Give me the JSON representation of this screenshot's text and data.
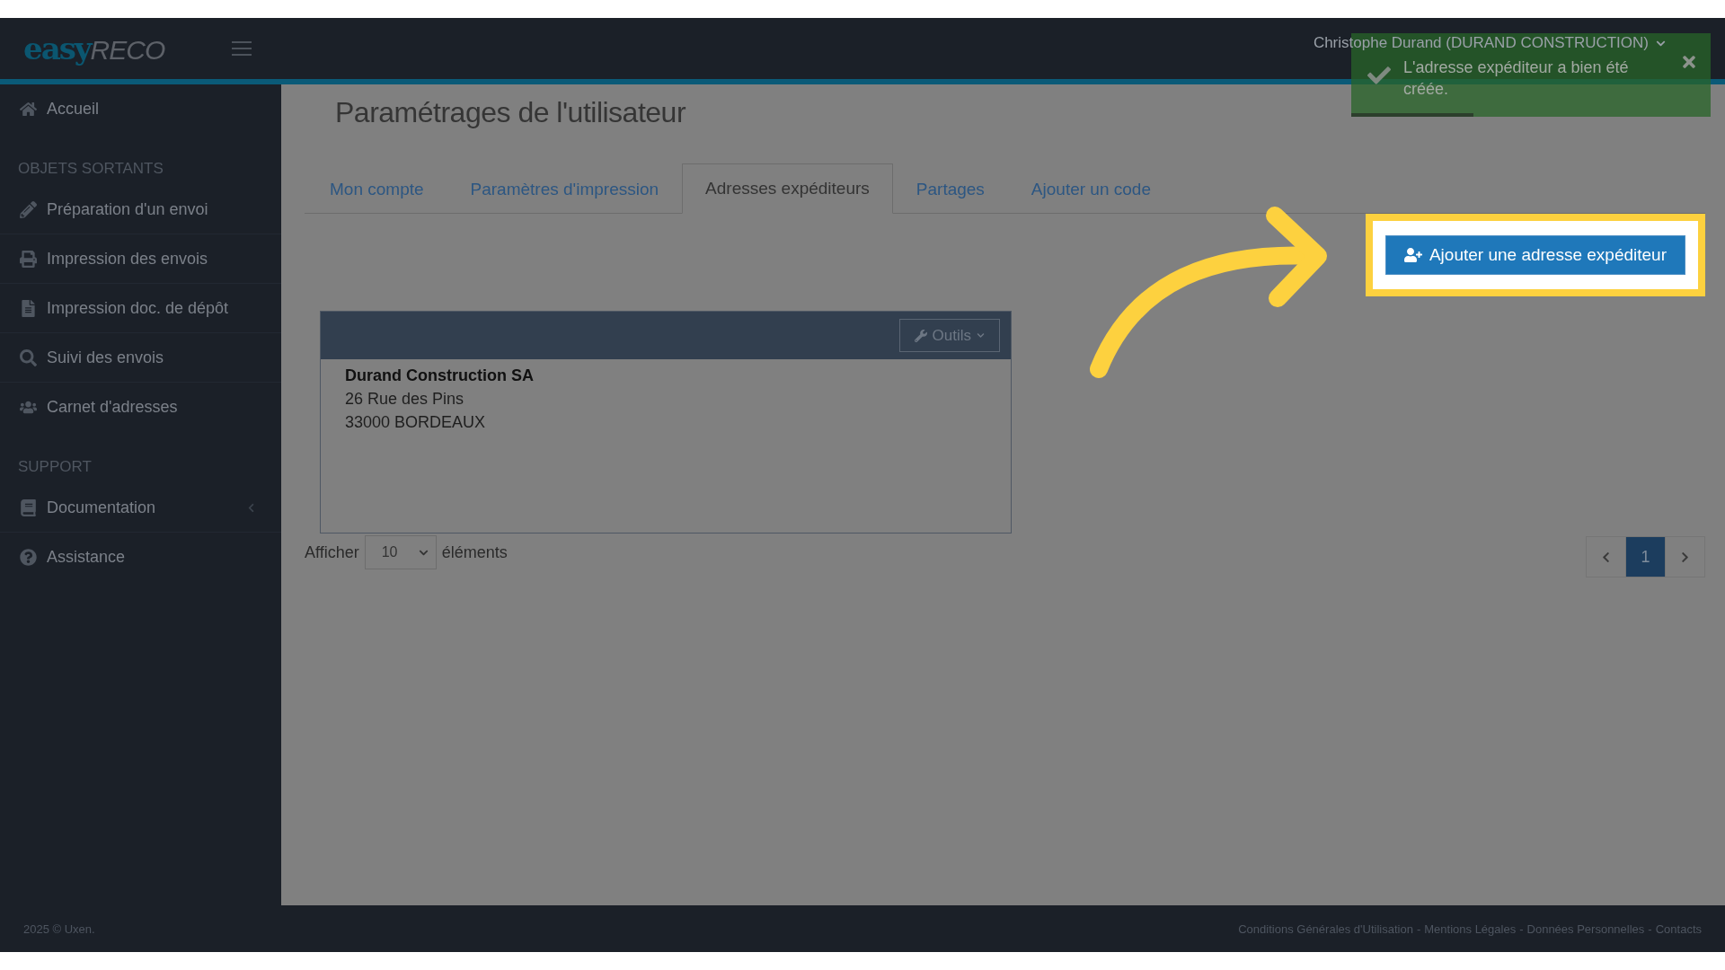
{
  "logo": {
    "brand": "easy",
    "product": "RECO"
  },
  "header": {
    "user": "Christophe Durand (DURAND CONSTRUCTION)"
  },
  "toast": {
    "message": "L'adresse expéditeur a bien été créée.",
    "level": 0.34
  },
  "sidebar": {
    "items": [
      {
        "kind": "link",
        "label": "Accueil"
      },
      {
        "kind": "section",
        "label": "OBJETS SORTANTS"
      },
      {
        "kind": "link",
        "label": "Préparation d'un envoi"
      },
      {
        "kind": "link",
        "label": "Impression des envois"
      },
      {
        "kind": "link",
        "label": "Impression doc. de dépôt"
      },
      {
        "kind": "link",
        "label": "Suivi des envois"
      },
      {
        "kind": "link",
        "label": "Carnet d'adresses"
      },
      {
        "kind": "section",
        "label": "SUPPORT"
      },
      {
        "kind": "link",
        "label": "Documentation",
        "expanded": false
      },
      {
        "kind": "link",
        "label": "Assistance"
      }
    ]
  },
  "page": {
    "title": "Paramétrages de l'utilisateur"
  },
  "tabs": [
    {
      "label": "Mon compte",
      "selected": false
    },
    {
      "label": "Paramètres d'impression",
      "selected": false
    },
    {
      "label": "Adresses expéditeurs",
      "selected": true
    },
    {
      "label": "Partages",
      "selected": false
    },
    {
      "label": "Ajouter un code",
      "selected": false
    }
  ],
  "add_button": {
    "label": "Ajouter une adresse expéditeur"
  },
  "address_card": {
    "tools_button": "Outils",
    "name": "Durand Construction SA",
    "lines": [
      "26 Rue des Pins",
      "33000 BORDEAUX"
    ]
  },
  "page_length": {
    "before": "Afficher",
    "value": "10",
    "after": "éléments"
  },
  "pagination": {
    "pages": [
      {
        "label": "1",
        "selected": true
      }
    ]
  },
  "footer": {
    "copyright": "2025 © Uxen.",
    "links": [
      "Conditions Générales d'Utilisation",
      "Mentions Légales",
      "Données Personnelles",
      "Contacts"
    ],
    "separator": "-"
  }
}
